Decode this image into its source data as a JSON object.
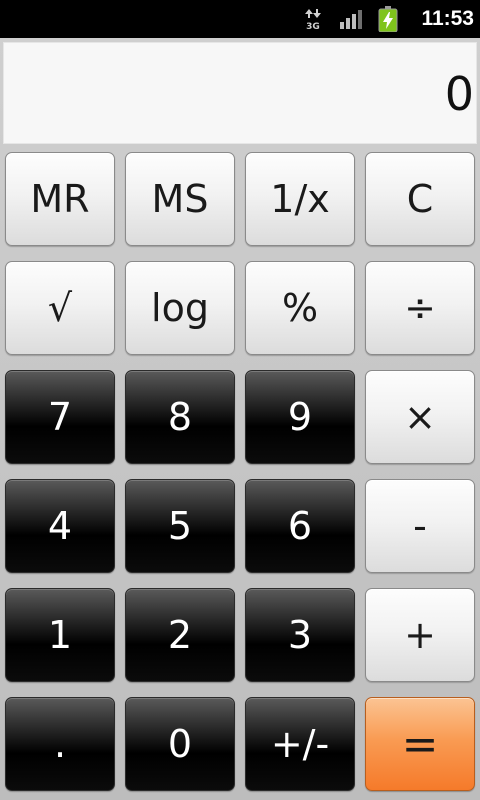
{
  "status_bar": {
    "time": "11:53",
    "network": "3G",
    "icons": [
      "data-arrows-3g-icon",
      "signal-strength-icon",
      "battery-charging-icon"
    ]
  },
  "display": {
    "value": "0"
  },
  "keys": {
    "mr": "MR",
    "ms": "MS",
    "reciprocal": "1/x",
    "clear": "C",
    "sqrt": "√",
    "log": "log",
    "percent": "%",
    "divide": "÷",
    "d7": "7",
    "d8": "8",
    "d9": "9",
    "multiply": "×",
    "d4": "4",
    "d5": "5",
    "d6": "6",
    "subtract": "-",
    "d1": "1",
    "d2": "2",
    "d3": "3",
    "add": "+",
    "decimal": ".",
    "d0": "0",
    "sign": "+/-",
    "equals": "="
  },
  "colors": {
    "status_bar": "#000000",
    "background": "#c9c9c9",
    "display": "#f7f7f7",
    "light_key": "#f2f2f2",
    "dark_key": "#000000",
    "equals_key": "#f78a3c",
    "battery_charging": "#7fc41c"
  }
}
